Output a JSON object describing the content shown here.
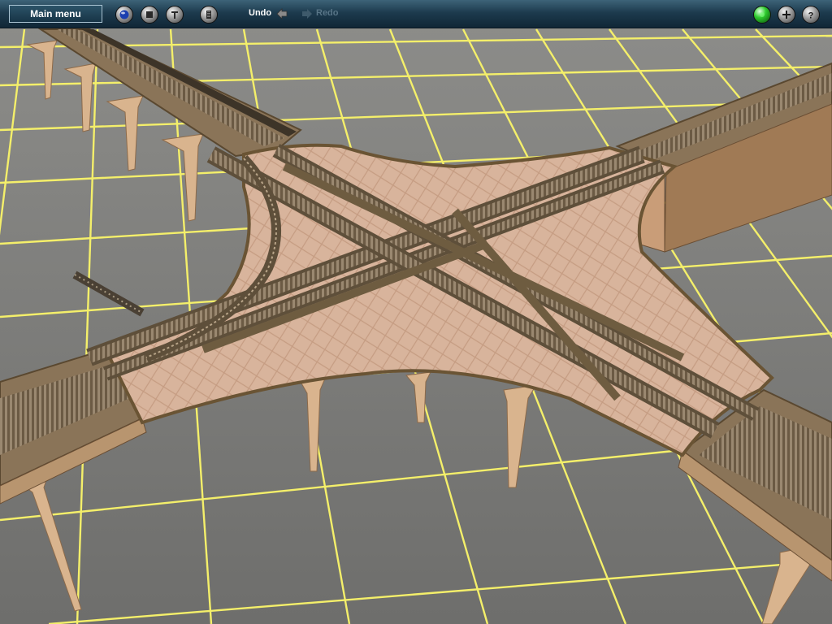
{
  "toolbar": {
    "main_menu_label": "Main menu",
    "undo_label": "Undo",
    "redo_label": "Redo"
  },
  "icons": {
    "left_tools": [
      "globe-icon",
      "square-icon",
      "wrench-icon",
      "film-icon"
    ],
    "right_tools": [
      "status-light-icon",
      "plus-icon",
      "help-icon"
    ]
  },
  "colors": {
    "toolbar": "#1d3b4e",
    "grid_line": "#f4ef6a",
    "ground": "#7a7a78",
    "deck": "#d8b49a",
    "ballast": "#6a5a40",
    "status_light": "#2ecb2e"
  }
}
